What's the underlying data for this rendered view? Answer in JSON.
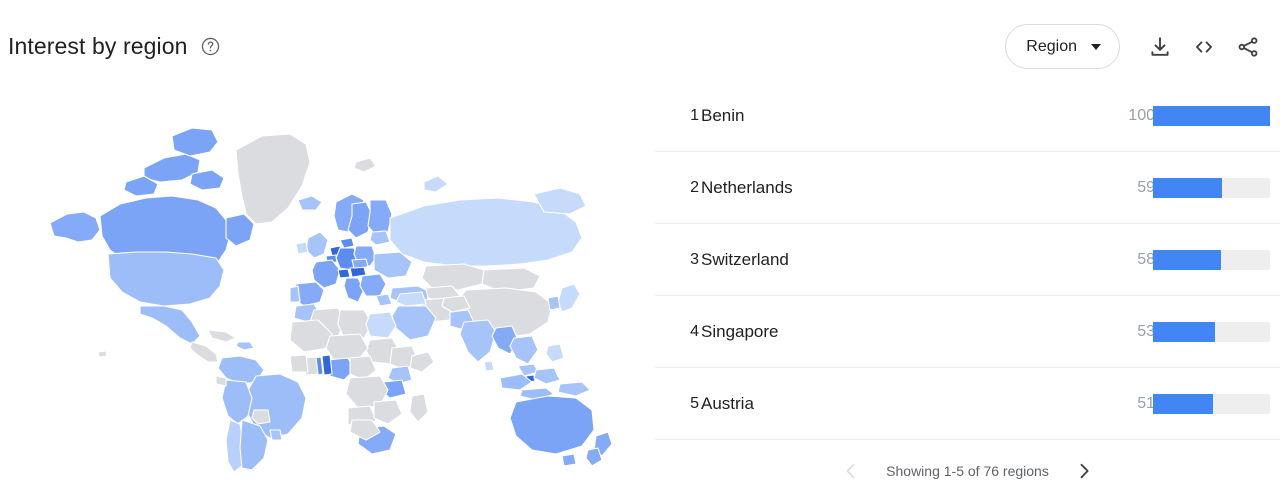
{
  "header": {
    "title": "Interest by region",
    "help_icon": "help-circle-icon",
    "region_select": {
      "label": "Region",
      "caret_icon": "chevron-down-icon"
    },
    "actions": [
      {
        "name": "download-button",
        "icon": "download-icon",
        "label": "Download"
      },
      {
        "name": "embed-button",
        "icon": "code-embed-icon",
        "label": "Embed"
      },
      {
        "name": "share-button",
        "icon": "share-icon",
        "label": "Share"
      }
    ]
  },
  "map": {
    "no_data_color": "#dadce0",
    "scale_colors": [
      "#e8f0fe",
      "#c6dafc",
      "#a6c3fa",
      "#85aaf7",
      "#5b8def",
      "#3367d6"
    ]
  },
  "pagination": {
    "text": "Showing 1-5 of 76 regions",
    "prev_icon": "chevron-left-icon",
    "next_icon": "chevron-right-icon",
    "prev_enabled": false,
    "next_enabled": true
  },
  "chart_data": {
    "type": "bar",
    "title": "Interest by region",
    "xlabel": "",
    "ylabel": "",
    "ylim": [
      0,
      100
    ],
    "orientation": "horizontal",
    "categories": [
      "Benin",
      "Netherlands",
      "Switzerland",
      "Singapore",
      "Austria"
    ],
    "values": [
      100,
      59,
      58,
      53,
      51
    ],
    "ranks": [
      1,
      2,
      3,
      4,
      5
    ],
    "bar_color": "#4285f4",
    "track_color": "#eeeeee",
    "total_regions": 76,
    "rows": [
      {
        "rank": "1",
        "name": "Benin",
        "value": "100",
        "pct": 100
      },
      {
        "rank": "2",
        "name": "Netherlands",
        "value": "59",
        "pct": 59
      },
      {
        "rank": "3",
        "name": "Switzerland",
        "value": "58",
        "pct": 58
      },
      {
        "rank": "4",
        "name": "Singapore",
        "value": "53",
        "pct": 53
      },
      {
        "rank": "5",
        "name": "Austria",
        "value": "51",
        "pct": 51
      }
    ]
  }
}
